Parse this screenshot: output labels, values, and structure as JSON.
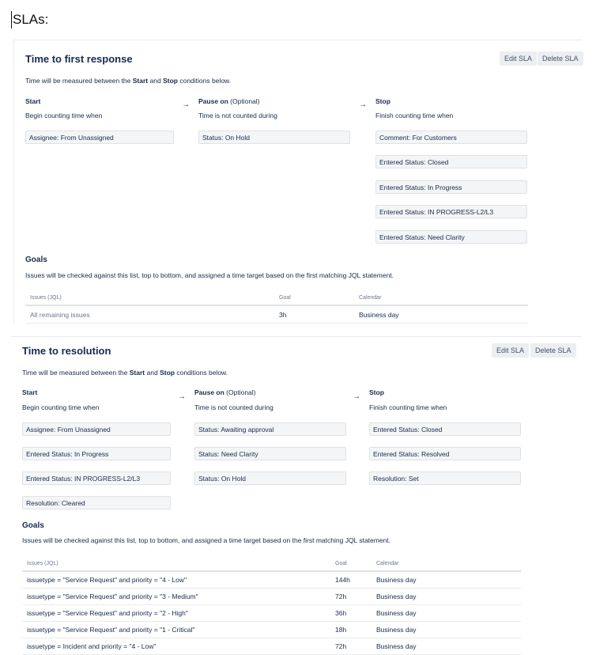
{
  "page": {
    "heading": "SLAs:"
  },
  "slas": [
    {
      "title": "Time to first response",
      "buttons": {
        "edit": "Edit SLA",
        "delete": "Delete SLA"
      },
      "desc": {
        "prefix": "Time will be measured between the",
        "start": "Start",
        "and": "and",
        "stop": "Stop",
        "suffix": "conditions below."
      },
      "start": {
        "label": "Start",
        "sub": "Begin counting time when",
        "conditions": [
          "Assignee: From Unassigned"
        ]
      },
      "pause": {
        "label": "Pause on",
        "optional": "(Optional)",
        "sub": "Time is not counted during",
        "conditions": [
          "Status: On Hold"
        ]
      },
      "stop": {
        "label": "Stop",
        "sub": "Finish counting time when",
        "conditions": [
          "Comment: For Customers",
          "Entered Status: Closed",
          "Entered Status: In Progress",
          "Entered Status: IN PROGRESS-L2/L3",
          "Entered Status: Need Clarity"
        ]
      },
      "arrow": "→",
      "goals": {
        "title": "Goals",
        "desc": "Issues will be checked against this list, top to bottom, and assigned a time target based on the first matching JQL statement.",
        "headers": {
          "issues": "Issues (JQL)",
          "goal": "Goal",
          "calendar": "Calendar"
        },
        "rows": [
          {
            "issues": "All remaining issues",
            "goal": "3h",
            "calendar": "Business day"
          }
        ]
      }
    },
    {
      "title": "Time to resolution",
      "buttons": {
        "edit": "Edit SLA",
        "delete": "Delete SLA"
      },
      "desc": {
        "prefix": "Time will be measured between the",
        "start": "Start",
        "and": "and",
        "stop": "Stop",
        "suffix": "conditions below."
      },
      "start": {
        "label": "Start",
        "sub": "Begin counting time when",
        "conditions": [
          "Assignee: From Unassigned",
          "Entered Status: In Progress",
          "Entered Status: IN PROGRESS-L2/L3",
          "Resolution: Cleared"
        ]
      },
      "pause": {
        "label": "Pause on",
        "optional": "(Optional)",
        "sub": "Time is not counted during",
        "conditions": [
          "Status: Awaiting approval",
          "Status: Need Clarity",
          "Status: On Hold"
        ]
      },
      "stop": {
        "label": "Stop",
        "sub": "Finish counting time when",
        "conditions": [
          "Entered Status: Closed",
          "Entered Status: Resolved",
          "Resolution: Set"
        ]
      },
      "arrow": "→",
      "goals": {
        "title": "Goals",
        "desc": "Issues will be checked against this list, top to bottom, and assigned a time target based on the first matching JQL statement.",
        "headers": {
          "issues": "Issues (JQL)",
          "goal": "Goal",
          "calendar": "Calendar"
        },
        "rows": [
          {
            "issues": "issuetype = \"Service Request\" and priority = \"4 - Low\"",
            "goal": "144h",
            "calendar": "Business day"
          },
          {
            "issues": "issuetype = \"Service Request\" and priority = \"3 - Medium\"",
            "goal": "72h",
            "calendar": "Business day"
          },
          {
            "issues": "issuetype = \"Service Request\" and priority = \"2 - High\"",
            "goal": "36h",
            "calendar": "Business day"
          },
          {
            "issues": "issuetype = \"Service Request\" and priority = \"1 - Critical\"",
            "goal": "18h",
            "calendar": "Business day"
          },
          {
            "issues": "issuetype = Incident and priority = \"4 - Low\"",
            "goal": "72h",
            "calendar": "Business day"
          }
        ]
      }
    }
  ]
}
